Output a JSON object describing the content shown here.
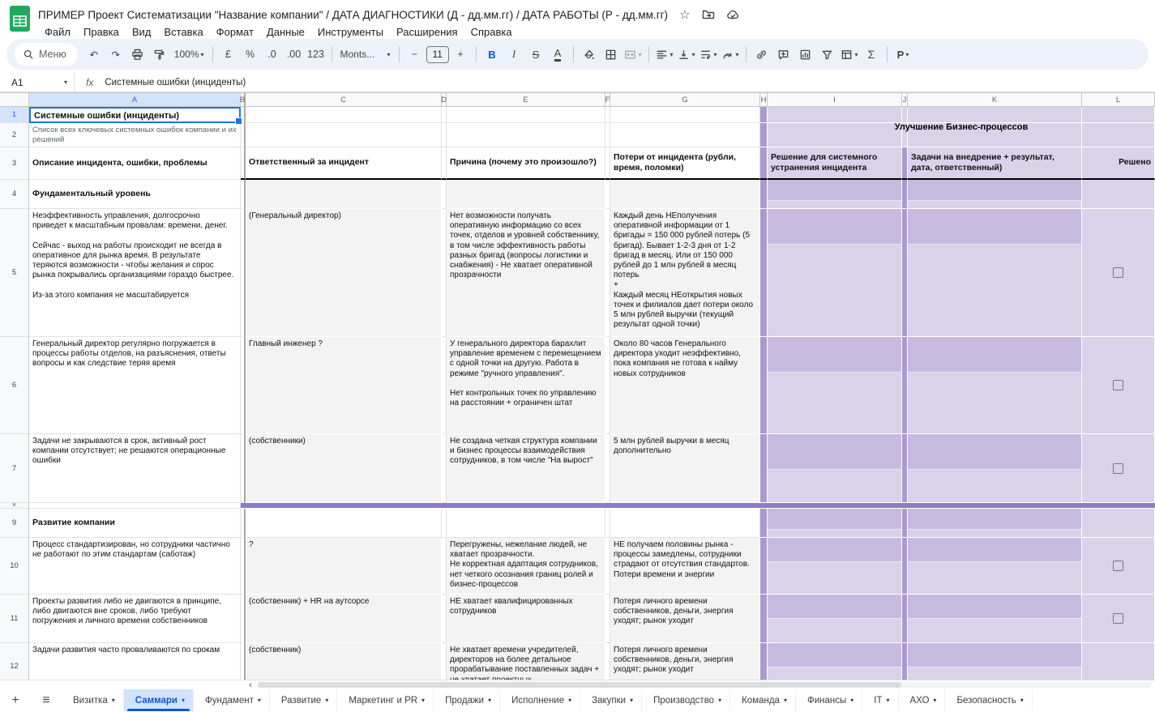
{
  "app": {
    "title": "ПРИМЕР Проект Систематизации \"Название компании\" / ДАТА ДИАГНОСТИКИ (Д - дд.мм.гг) / ДАТА РАБОТЫ (Р - дд.мм.гг)",
    "menus": [
      "Файл",
      "Правка",
      "Вид",
      "Вставка",
      "Формат",
      "Данные",
      "Инструменты",
      "Расширения",
      "Справка"
    ]
  },
  "toolbar": {
    "search_label": "Меню",
    "zoom": "100%",
    "currency": "£",
    "percent": "%",
    "decimal_decrease": ".0",
    "decimal_increase": ".00",
    "number_format": "123",
    "font_name": "Monts...",
    "font_size": "11",
    "bold": "B",
    "italic": "I",
    "strikethrough": "S",
    "text_color": "A",
    "minus": "−",
    "plus": "+",
    "functions": "Σ",
    "addon": "P"
  },
  "formula_bar": {
    "cell_ref": "A1",
    "fx": "fx",
    "value": "Системные ошибки (инциденты)"
  },
  "colors": {
    "accent": "#1a73e8",
    "purple_dark": "#8e7cc3",
    "purple_medium": "#a99bd0",
    "purple_block": "#c7bae1",
    "purple_light": "#d9d2e9",
    "cell_gray": "#f3f3f3"
  },
  "grid": {
    "columns": [
      "A",
      "B",
      "C",
      "D",
      "E",
      "F",
      "G",
      "H",
      "I",
      "J",
      "K",
      "L"
    ],
    "rows": [
      "1",
      "2",
      "3",
      "4",
      "5",
      "6",
      "7",
      "8",
      "9",
      "10",
      "11",
      "12"
    ],
    "merged_header": "Улучшение Бизнес-процессов",
    "cells": {
      "a1": "Системные ошибки (инциденты)",
      "a2": "Список всех ключевых системных ошибок компании и их решений",
      "a3": "Описание инцидента, ошибки, проблемы",
      "c3": "Ответственный за инцидент",
      "e3": "Причина (почему это произошло?)",
      "g3": "Потери от инцидента (рубли, время, поломки)",
      "i3": "Решение для системного устранения инцидента",
      "k3": "Задачи на внедрение + результат, дата, ответственный)",
      "l3": "Решено",
      "a4": "Фундаментальный уровень",
      "a5": "Неэффективность управления, долгосрочно приведет к масштабным провалам: времени, денег.\n\nСейчас - выход на работы происходит не всегда в оперативное для рынка время. В результате теряются возможности - чтобы желания и спрос рынка покрывались организациями гораздо быстрее.\n\nИз-за этого компания не масштабируется",
      "c5": "(Генеральный директор)",
      "e5": "Нет возможности получать оперативную информацию со всех точек, отделов и уровней собственнику, в том числе эффективность работы разных бригад (вопросы логистики и снабжения) - Не хватает оперативной прозрачности",
      "g5": "Каждый день НЕполучения оперативной информации от 1 бригады = 150 000 рублей потерь (5 бригад). Бывает 1-2-3 дня от 1-2 бригад в месяц. Или от 150 000 рублей до 1 млн рублей в месяц потерь\n+\nКаждый месяц НЕоткрытия новых точек и филиалов дает потери около 5 млн рублей выручки (текущий результат одной точки)",
      "a6": "Генеральный директор регулярно погружается в процессы работы отделов, на разъяснения, ответы вопросы и как следствие теряя время",
      "c6": "Главный инженер ?",
      "e6": "У генерального директора барахлит управление временем с перемещением с одной точки на другую. Работа в режиме \"ручного управления\".\n\nНет контрольных точек по управлению на расстоянии + ограничен штат",
      "g6": "Около 80 часов Генерального директора уходит неэффективно, пока компания не готова к найму новых сотрудников",
      "a7": "Задачи не закрываются в срок, активный рост компании отсутствует; не решаются операционные ошибки",
      "c7": "(собственники)",
      "e7": "Не создана четкая структура компании и бизнес процессы взаимодействия сотрудников, в том числе \"На вырост\"",
      "g7": "5 млн рублей выручки в месяц дополнительно",
      "a9": "Развитие компании",
      "a10": "Процесс стандартизирован, но сотрудники частично не работают по этим стандартам (саботаж)",
      "c10": "?",
      "e10": "Перегружены, нежелание людей, не хватает прозрачности.\nНе корректная адаптация сотрудников, нет четкого осознания границ ролей и бизнес-процессов",
      "g10": "НЕ получаем половины рынка - процессы замедлены, сотрудники страдают от отсутствия стандартов. Потери времени и энергии",
      "a11": "Проекты развития либо не двигаются в принципе, либо двигаются вне сроков, либо требуют погружения и личного времени собственников",
      "c11": "(собственник) + HR на аутсорсе",
      "e11": "НЕ хватает квалифицированных сотрудников",
      "g11": "Потеря личного времени собственников, деньги, энергия уходят; рынок уходит",
      "a12": "Задачи развития часто проваливаются по срокам",
      "c12": "(собственник)",
      "e12": "Не хватает времени учредителей, директоров на более детальное прорабатывание поставленных задач + не хватает проектных",
      "g12": "Потеря личного времени собственников, деньги, энергия уходят; рынок уходит"
    }
  },
  "tabs": {
    "active": "Саммари",
    "items": [
      "Визитка",
      "Саммари",
      "Фундамент",
      "Развитие",
      "Маркетинг и PR",
      "Продажи",
      "Исполнение",
      "Закупки",
      "Производство",
      "Команда",
      "Финансы",
      "IT",
      "АХО",
      "Безопасность"
    ]
  }
}
